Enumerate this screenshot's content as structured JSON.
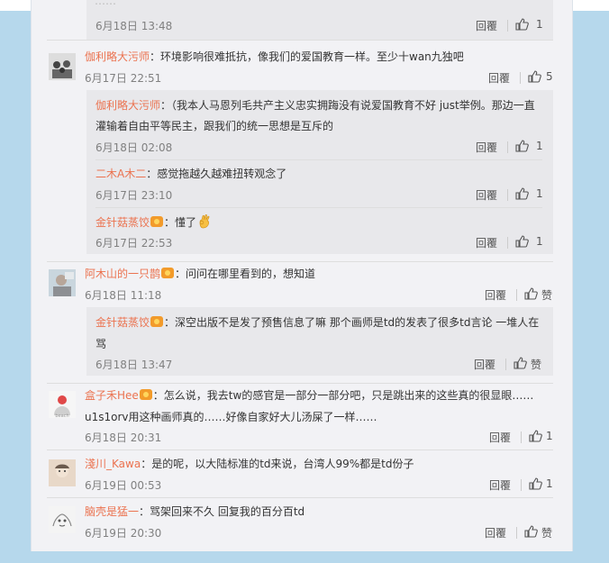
{
  "top": {
    "cut_text": "……",
    "time": "6月18日 13:48",
    "reply": "回覆",
    "likes": "1"
  },
  "comments": [
    {
      "user": "伽利略大污师",
      "text": "：环境影响很难抵抗，像我们的爱国教育一样。至少十wan九独吧",
      "time": "6月17日 22:51",
      "reply": "回覆",
      "likes": "5",
      "replies": [
        {
          "user": "伽利略大污师",
          "text1": "：（我本人马恩列毛共产主义忠实拥踇没有说爱国教育不好 just举例。那边一直",
          "text2": "灌输着自由平等民主，跟我们的统一思想是互斥的",
          "time": "6月18日 02:08",
          "reply": "回覆",
          "likes": "1"
        },
        {
          "user": "二木A木二",
          "text": "：感觉拖越久越难扭转观念了",
          "time": "6月17日 23:10",
          "reply": "回覆",
          "likes": "1"
        },
        {
          "user": "金针菇蒸饺",
          "text": "：懂了",
          "time": "6月17日 22:53",
          "reply": "回覆",
          "likes": "1"
        }
      ]
    },
    {
      "user": "阿木山的一只鹊",
      "text": "：问问在哪里看到的，想知道",
      "time": "6月18日 11:18",
      "reply": "回覆",
      "likes": "赞",
      "replies": [
        {
          "user": "金针菇蒸饺",
          "text1": "：深空出版不是发了预售信息了嘛 那个画师是td的发表了很多td言论 一堆人在",
          "text2": "骂",
          "time": "6月18日 13:47",
          "reply": "回覆",
          "likes": "赞"
        }
      ]
    },
    {
      "user": "盒子禾Hee",
      "text1": "：怎么说，我去tw的感官是一部分一部分吧，只是跳出来的这些真的很显眼……",
      "text2": "u1s1orv用这种画师真的……好像自家好大儿汤屎了一样……",
      "time": "6月18日 20:31",
      "reply": "回覆",
      "likes": "1"
    },
    {
      "user": "淺川_Kawa",
      "text": "：是的呢，以大陆标准的td来说，台湾人99%都是td份子",
      "time": "6月19日 00:53",
      "reply": "回覆",
      "likes": "1"
    },
    {
      "user": "脑壳是猛一",
      "text": "：骂架回来不久 回复我的百分百td",
      "time": "6月19日 20:30",
      "reply": "回覆",
      "likes": "赞"
    }
  ],
  "icons": {
    "like": "thumbs-up-icon",
    "badge": "member-badge-icon",
    "emoji": "ok-hand-emoji-icon"
  }
}
